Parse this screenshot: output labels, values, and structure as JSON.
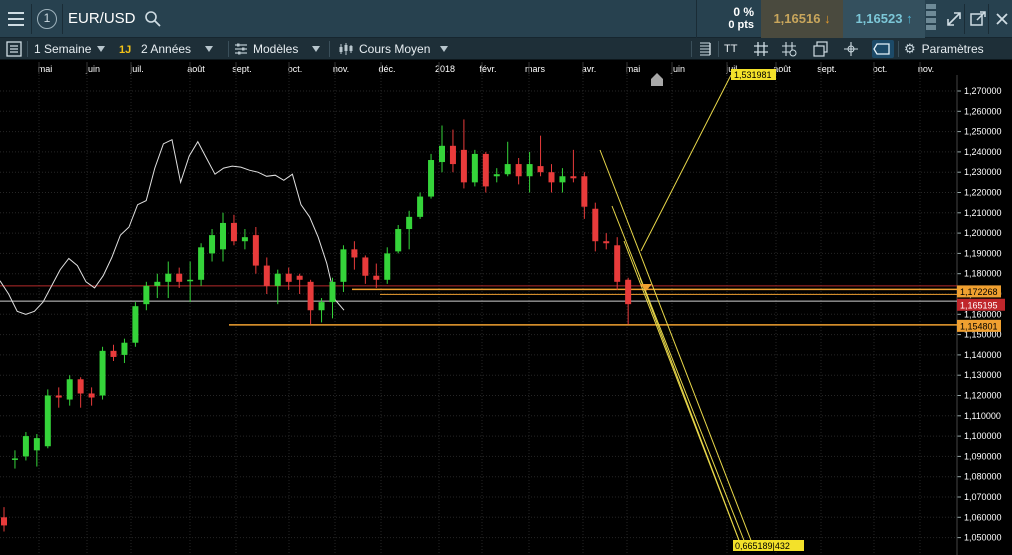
{
  "header": {
    "index_badge": "1",
    "symbol": "EUR/USD",
    "change_pct": "0 %",
    "change_pts": "0 pts",
    "sell_price": "1,16516",
    "buy_price": "1,16523"
  },
  "toolbar": {
    "timeframe": "1 Semaine",
    "badge": "1J",
    "range": "2 Années",
    "models": "Modèles",
    "price_type": "Cours Moyen",
    "text_tool": "TT",
    "settings": "Paramètres"
  },
  "chart_data": {
    "type": "candlestick",
    "instrument": "EUR/USD",
    "interval": "1 Semaine",
    "x_labels": [
      "mai",
      "juin",
      "juil.",
      "août",
      "sept.",
      "oct.",
      "nov.",
      "déc.",
      "2018",
      "févr.",
      "mars",
      "avr.",
      "mai",
      "juin",
      "juil.",
      "août",
      "sept.",
      "oct.",
      "nov."
    ],
    "y_ticks": [
      "1,270000",
      "1,260000",
      "1,250000",
      "1,240000",
      "1,230000",
      "1,220000",
      "1,210000",
      "1,200000",
      "1,190000",
      "1,180000",
      "1,170000",
      "1,160000",
      "1,150000",
      "1,140000",
      "1,130000",
      "1,120000",
      "1,110000",
      "1,100000",
      "1,090000",
      "1,080000",
      "1,070000",
      "1,060000",
      "1,050000"
    ],
    "ylim": [
      1.047,
      1.274
    ],
    "current_price_label": "1,165195",
    "current_price": 1.165195,
    "levels": [
      {
        "label": "1,172268",
        "value": 1.172268,
        "color": "#f0a030"
      },
      {
        "label": "1,154801",
        "value": 1.154801,
        "color": "#f0a030"
      }
    ],
    "projection_labels": [
      {
        "label": "1,531981",
        "color": "#f3e12a"
      },
      {
        "label": "0,665189|432",
        "color": "#f3e12a"
      }
    ],
    "red_line_value": 1.174,
    "white_line_value": 1.1665,
    "candles": [
      {
        "o": 1.06,
        "h": 1.065,
        "l": 1.053,
        "c": 1.056
      },
      {
        "o": 1.089,
        "h": 1.093,
        "l": 1.084,
        "c": 1.089
      },
      {
        "o": 1.09,
        "h": 1.102,
        "l": 1.088,
        "c": 1.1
      },
      {
        "o": 1.093,
        "h": 1.101,
        "l": 1.085,
        "c": 1.099
      },
      {
        "o": 1.095,
        "h": 1.123,
        "l": 1.094,
        "c": 1.12
      },
      {
        "o": 1.12,
        "h": 1.124,
        "l": 1.114,
        "c": 1.119
      },
      {
        "o": 1.118,
        "h": 1.13,
        "l": 1.115,
        "c": 1.128
      },
      {
        "o": 1.128,
        "h": 1.129,
        "l": 1.114,
        "c": 1.121
      },
      {
        "o": 1.121,
        "h": 1.124,
        "l": 1.115,
        "c": 1.119
      },
      {
        "o": 1.12,
        "h": 1.144,
        "l": 1.118,
        "c": 1.142
      },
      {
        "o": 1.142,
        "h": 1.145,
        "l": 1.137,
        "c": 1.139
      },
      {
        "o": 1.14,
        "h": 1.148,
        "l": 1.136,
        "c": 1.146
      },
      {
        "o": 1.146,
        "h": 1.166,
        "l": 1.144,
        "c": 1.164
      },
      {
        "o": 1.165,
        "h": 1.176,
        "l": 1.162,
        "c": 1.174
      },
      {
        "o": 1.174,
        "h": 1.18,
        "l": 1.168,
        "c": 1.176
      },
      {
        "o": 1.176,
        "h": 1.186,
        "l": 1.168,
        "c": 1.18
      },
      {
        "o": 1.18,
        "h": 1.183,
        "l": 1.173,
        "c": 1.176
      },
      {
        "o": 1.177,
        "h": 1.186,
        "l": 1.166,
        "c": 1.177
      },
      {
        "o": 1.177,
        "h": 1.195,
        "l": 1.174,
        "c": 1.193
      },
      {
        "o": 1.19,
        "h": 1.202,
        "l": 1.186,
        "c": 1.199
      },
      {
        "o": 1.192,
        "h": 1.21,
        "l": 1.186,
        "c": 1.205
      },
      {
        "o": 1.205,
        "h": 1.209,
        "l": 1.194,
        "c": 1.196
      },
      {
        "o": 1.196,
        "h": 1.202,
        "l": 1.192,
        "c": 1.198
      },
      {
        "o": 1.199,
        "h": 1.203,
        "l": 1.18,
        "c": 1.184
      },
      {
        "o": 1.184,
        "h": 1.188,
        "l": 1.17,
        "c": 1.174
      },
      {
        "o": 1.174,
        "h": 1.182,
        "l": 1.165,
        "c": 1.18
      },
      {
        "o": 1.18,
        "h": 1.183,
        "l": 1.172,
        "c": 1.176
      },
      {
        "o": 1.179,
        "h": 1.18,
        "l": 1.17,
        "c": 1.177
      },
      {
        "o": 1.176,
        "h": 1.177,
        "l": 1.155,
        "c": 1.162
      },
      {
        "o": 1.162,
        "h": 1.168,
        "l": 1.156,
        "c": 1.166
      },
      {
        "o": 1.166,
        "h": 1.178,
        "l": 1.158,
        "c": 1.176
      },
      {
        "o": 1.176,
        "h": 1.194,
        "l": 1.171,
        "c": 1.192
      },
      {
        "o": 1.192,
        "h": 1.196,
        "l": 1.182,
        "c": 1.188
      },
      {
        "o": 1.188,
        "h": 1.189,
        "l": 1.175,
        "c": 1.179
      },
      {
        "o": 1.179,
        "h": 1.185,
        "l": 1.173,
        "c": 1.177
      },
      {
        "o": 1.177,
        "h": 1.193,
        "l": 1.175,
        "c": 1.19
      },
      {
        "o": 1.191,
        "h": 1.204,
        "l": 1.19,
        "c": 1.202
      },
      {
        "o": 1.202,
        "h": 1.211,
        "l": 1.192,
        "c": 1.208
      },
      {
        "o": 1.208,
        "h": 1.22,
        "l": 1.207,
        "c": 1.218
      },
      {
        "o": 1.218,
        "h": 1.239,
        "l": 1.217,
        "c": 1.236
      },
      {
        "o": 1.235,
        "h": 1.253,
        "l": 1.23,
        "c": 1.243
      },
      {
        "o": 1.243,
        "h": 1.251,
        "l": 1.23,
        "c": 1.234
      },
      {
        "o": 1.241,
        "h": 1.256,
        "l": 1.222,
        "c": 1.225
      },
      {
        "o": 1.225,
        "h": 1.241,
        "l": 1.223,
        "c": 1.239
      },
      {
        "o": 1.239,
        "h": 1.24,
        "l": 1.22,
        "c": 1.223
      },
      {
        "o": 1.228,
        "h": 1.232,
        "l": 1.225,
        "c": 1.229
      },
      {
        "o": 1.229,
        "h": 1.245,
        "l": 1.228,
        "c": 1.234
      },
      {
        "o": 1.234,
        "h": 1.237,
        "l": 1.224,
        "c": 1.228
      },
      {
        "o": 1.228,
        "h": 1.24,
        "l": 1.22,
        "c": 1.234
      },
      {
        "o": 1.233,
        "h": 1.248,
        "l": 1.228,
        "c": 1.23
      },
      {
        "o": 1.23,
        "h": 1.234,
        "l": 1.22,
        "c": 1.225
      },
      {
        "o": 1.225,
        "h": 1.232,
        "l": 1.22,
        "c": 1.228
      },
      {
        "o": 1.228,
        "h": 1.241,
        "l": 1.225,
        "c": 1.227
      },
      {
        "o": 1.228,
        "h": 1.23,
        "l": 1.207,
        "c": 1.213
      },
      {
        "o": 1.212,
        "h": 1.215,
        "l": 1.191,
        "c": 1.196
      },
      {
        "o": 1.196,
        "h": 1.2,
        "l": 1.192,
        "c": 1.195
      },
      {
        "o": 1.194,
        "h": 1.198,
        "l": 1.172,
        "c": 1.176
      },
      {
        "o": 1.177,
        "h": 1.178,
        "l": 1.155,
        "c": 1.165
      }
    ],
    "white_line": [
      1.1765,
      1.17,
      1.1615,
      1.16,
      1.1615,
      1.166,
      1.174,
      1.182,
      1.1875,
      1.184,
      1.176,
      1.173,
      1.179,
      1.188,
      1.199,
      1.203,
      1.214,
      1.216,
      1.232,
      1.244,
      1.246,
      1.225,
      1.238,
      1.245,
      1.237,
      1.229,
      1.232,
      1.233,
      1.2325,
      1.231,
      1.23,
      1.228,
      1.2285,
      1.226,
      1.229,
      1.214,
      1.208,
      1.198,
      1.185,
      1.167,
      1.162
    ]
  }
}
